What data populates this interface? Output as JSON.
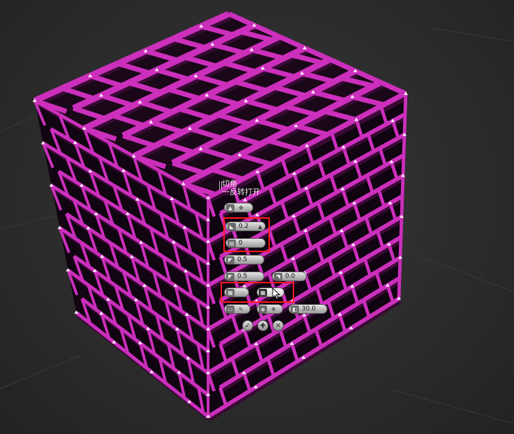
{
  "caddy": {
    "title_line1": "切角",
    "title_line2": "一反转打开",
    "icons": {
      "operation": "chamfer-type-icon",
      "amount": "amount-icon",
      "segments": "segments-icon",
      "tension": "tension-icon",
      "inset": "inset-icon",
      "depth": "depth-icon",
      "open": "open-icon",
      "smooth": "smooth-icon",
      "threshold": "threshold-icon",
      "ok": "check-icon",
      "apply": "plus-icon",
      "cancel": "close-icon"
    },
    "amount_value": "0.2",
    "segments_value": "0",
    "tension_value": "0.5",
    "inset_value": "0.5",
    "depth_value": "0.0",
    "threshold_value": "30.0"
  },
  "colors": {
    "mesh_face": "#cc2fbc",
    "mesh_dark": "#3a0a36",
    "background": "#2e2e2e",
    "highlight": "#ff1a1a"
  }
}
